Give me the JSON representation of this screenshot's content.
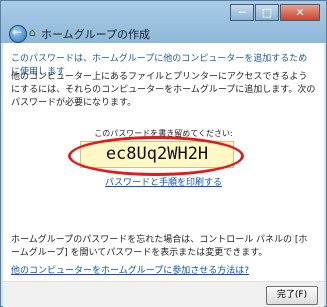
{
  "window": {
    "title": "ホームグループの作成",
    "minimize": "─",
    "maximize": "□",
    "close": "✕"
  },
  "content": {
    "headline": "このパスワードは、ホームグループに他のコンピューターを追加するために使用します",
    "paragraph": "他のコンピューター上にあるファイルとプリンターにアクセスできるようにするには、それらのコンピューターをホームグループに追加します。次のパスワードが必要になります。",
    "password_prompt": "このパスワードを書き留めてください:",
    "password": "ec8Uq2WH2H",
    "print_link": "パスワードと手順を印刷する",
    "forgot_paragraph": "ホームグループのパスワードを忘れた場合は、コントロール パネルの [ホームグループ] を開いてパスワードを表示または変更できます。",
    "join_link": "他のコンピューターをホームグループに参加させる方法は?"
  },
  "footer": {
    "finish_button": "完了(F)"
  }
}
